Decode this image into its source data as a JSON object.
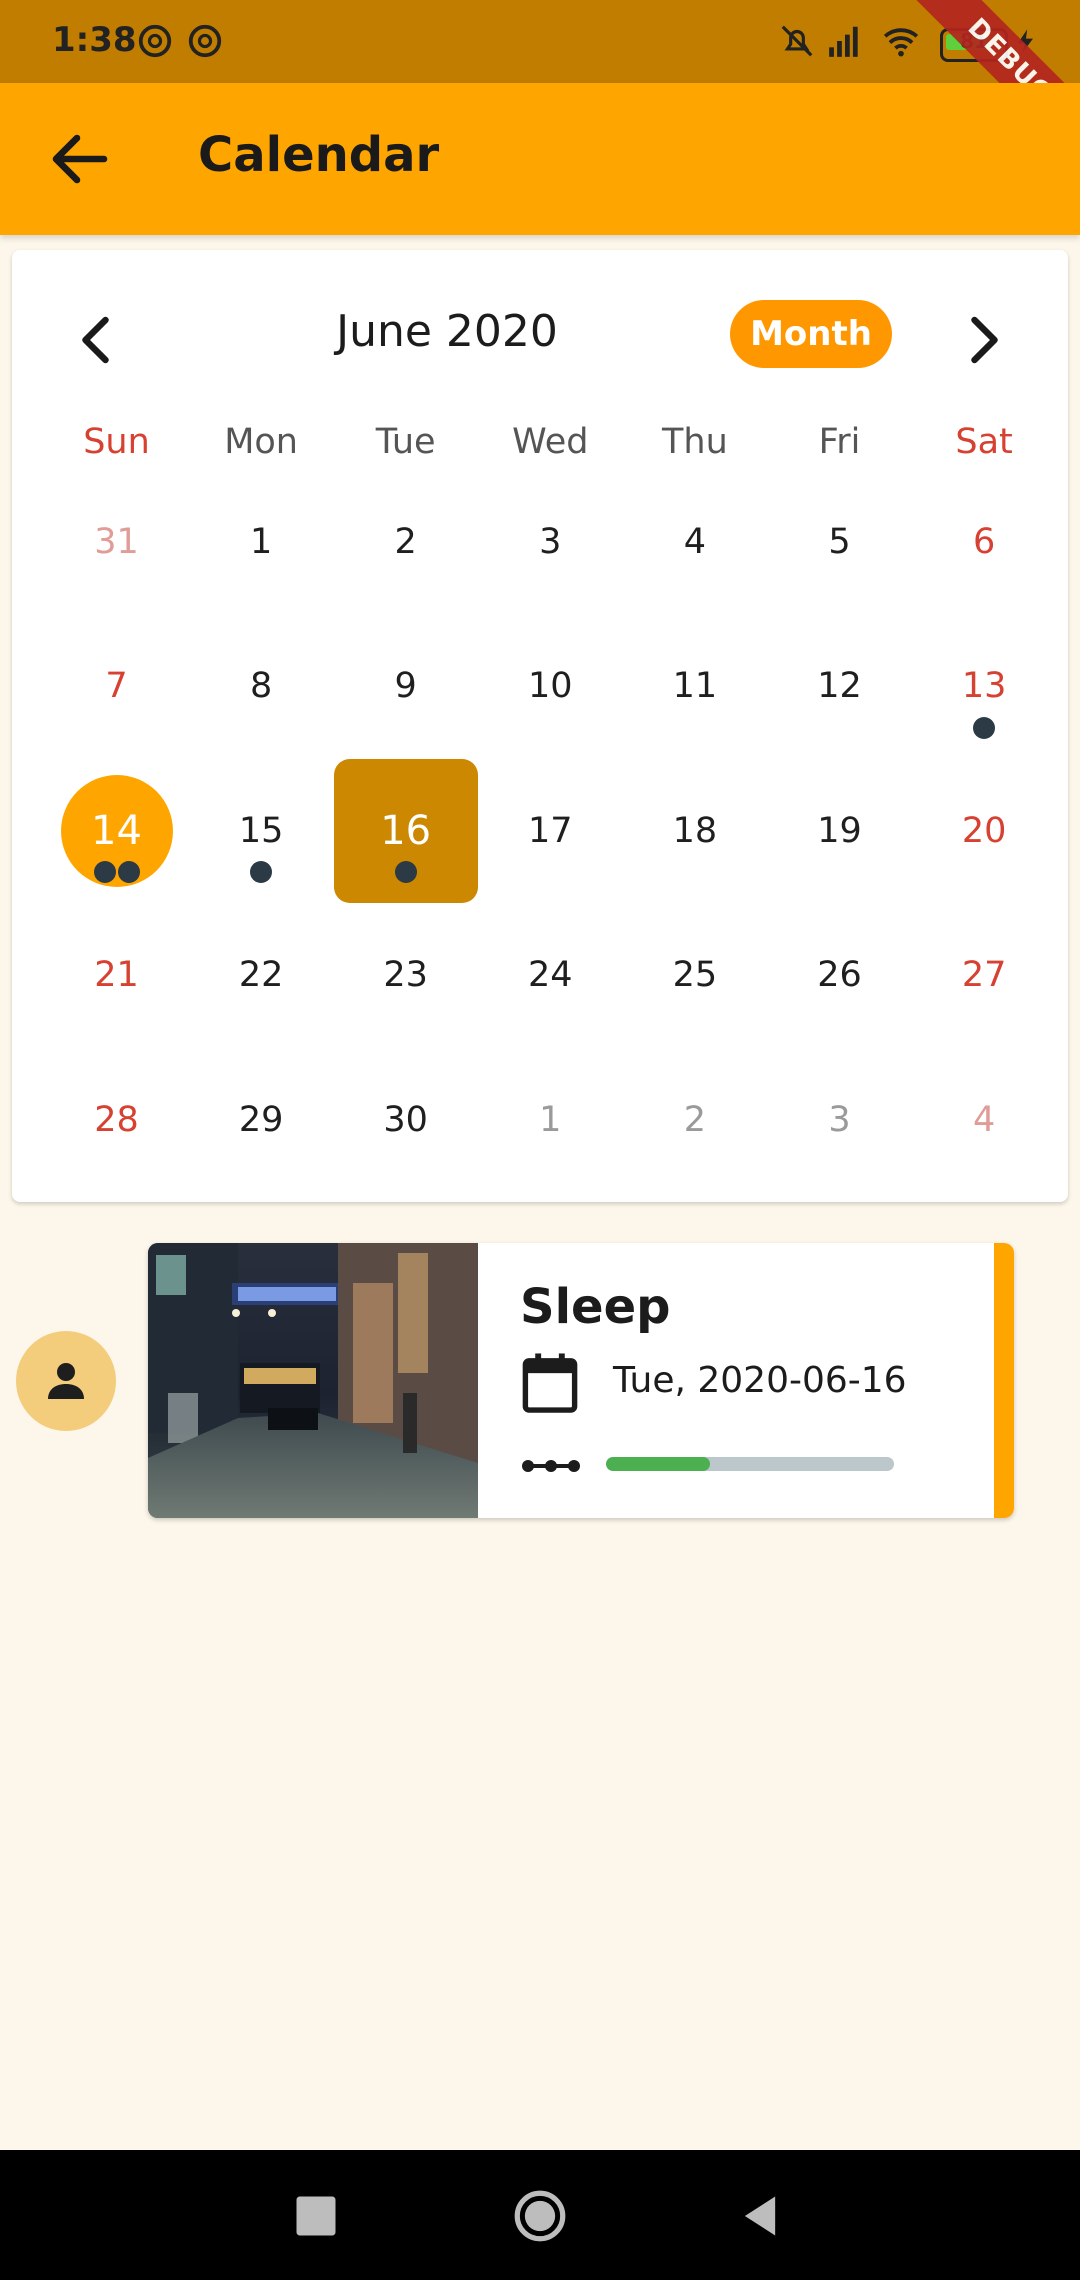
{
  "status_bar": {
    "time": "1:38",
    "battery_level": "81",
    "icons": [
      "notification-icon",
      "notification-icon",
      "mute-icon",
      "signal-icon",
      "wifi-icon",
      "battery-icon",
      "charging-icon"
    ]
  },
  "debug_banner": "DEBUG",
  "app_bar": {
    "title": "Calendar",
    "back_icon": "arrow-back-icon"
  },
  "calendar": {
    "month_title": "June 2020",
    "format_button": "Month",
    "weekdays": [
      "Sun",
      "Mon",
      "Tue",
      "Wed",
      "Thu",
      "Fri",
      "Sat"
    ],
    "weeks": [
      [
        {
          "d": "31",
          "out": true
        },
        {
          "d": "1"
        },
        {
          "d": "2"
        },
        {
          "d": "3"
        },
        {
          "d": "4"
        },
        {
          "d": "5"
        },
        {
          "d": "6"
        }
      ],
      [
        {
          "d": "7"
        },
        {
          "d": "8"
        },
        {
          "d": "9"
        },
        {
          "d": "10"
        },
        {
          "d": "11"
        },
        {
          "d": "12"
        },
        {
          "d": "13",
          "events": 1
        }
      ],
      [
        {
          "d": "14",
          "today": true,
          "events": 2
        },
        {
          "d": "15",
          "events": 1
        },
        {
          "d": "16",
          "selected": true,
          "events": 1
        },
        {
          "d": "17"
        },
        {
          "d": "18"
        },
        {
          "d": "19"
        },
        {
          "d": "20"
        }
      ],
      [
        {
          "d": "21"
        },
        {
          "d": "22"
        },
        {
          "d": "23"
        },
        {
          "d": "24"
        },
        {
          "d": "25"
        },
        {
          "d": "26"
        },
        {
          "d": "27"
        }
      ],
      [
        {
          "d": "28"
        },
        {
          "d": "29"
        },
        {
          "d": "30"
        },
        {
          "d": "1",
          "out": true
        },
        {
          "d": "2",
          "out": true
        },
        {
          "d": "3",
          "out": true
        },
        {
          "d": "4",
          "out": true
        }
      ]
    ],
    "colors": {
      "today": "#ffa500",
      "selected": "#cc8800",
      "weekend": "#d64131",
      "marker": "#2b3a44"
    }
  },
  "events": [
    {
      "title": "Sleep",
      "date": "Tue, 2020-06-16",
      "progress": 0.36,
      "avatar_icon": "person-icon",
      "thumbnail": "night-street-image",
      "accent_color": "#ffa500",
      "progress_color": "#4caf50"
    }
  ]
}
